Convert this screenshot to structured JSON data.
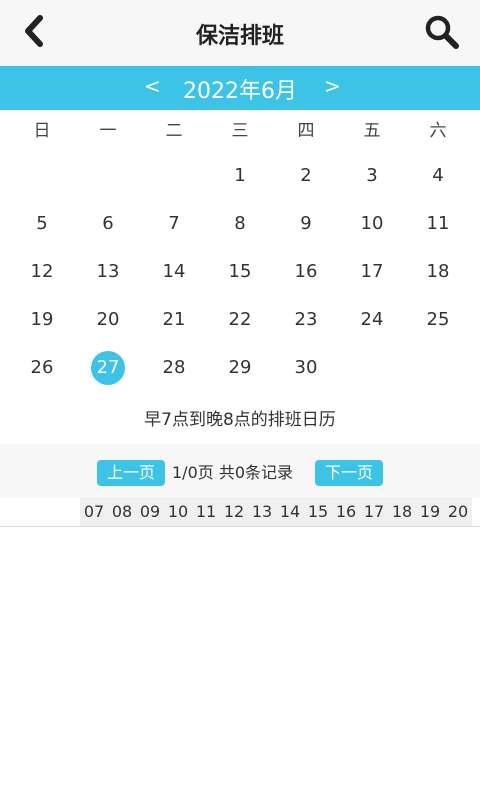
{
  "header": {
    "title": "保洁排班",
    "back_icon": "chevron-left-icon",
    "search_icon": "search-icon"
  },
  "calendar": {
    "prev": "<",
    "next": ">",
    "month_label": "2022年6月",
    "weekdays": [
      "日",
      "一",
      "二",
      "三",
      "四",
      "五",
      "六"
    ],
    "weeks": [
      [
        "",
        "",
        "",
        "1",
        "2",
        "3",
        "4"
      ],
      [
        "5",
        "6",
        "7",
        "8",
        "9",
        "10",
        "11"
      ],
      [
        "12",
        "13",
        "14",
        "15",
        "16",
        "17",
        "18"
      ],
      [
        "19",
        "20",
        "21",
        "22",
        "23",
        "24",
        "25"
      ],
      [
        "26",
        "27",
        "28",
        "29",
        "30",
        "",
        ""
      ]
    ],
    "selected_day": "27",
    "accent_color": "#3cc3e6"
  },
  "note": "早7点到晚8点的排班日历",
  "pager": {
    "prev_label": "上一页",
    "info": "1/0页 共0条记录",
    "next_label": "下一页"
  },
  "hours": [
    "07",
    "08",
    "09",
    "10",
    "11",
    "12",
    "13",
    "14",
    "15",
    "16",
    "17",
    "18",
    "19",
    "20"
  ]
}
